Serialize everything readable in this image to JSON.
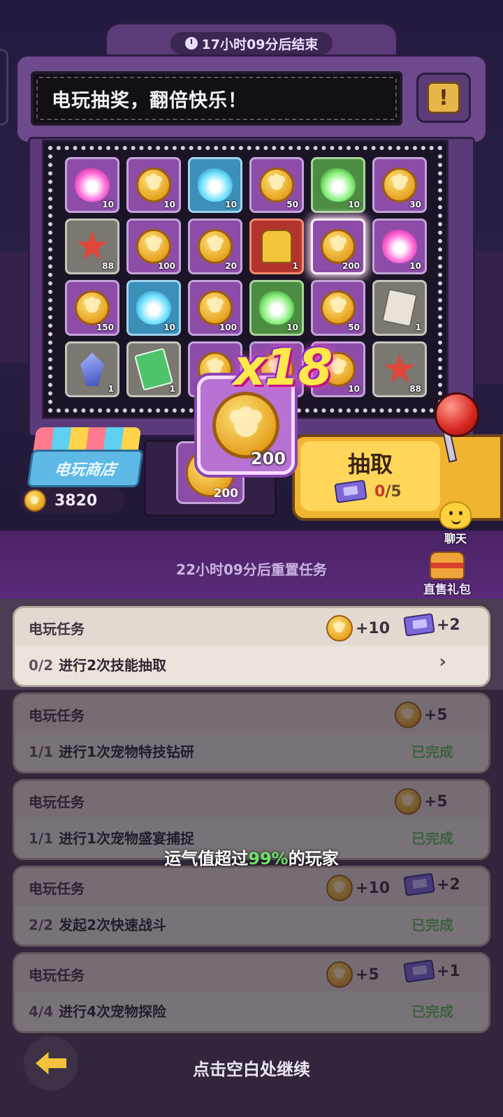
{
  "event": {
    "timer_text": "17小时09分后结束",
    "marquee_text": "电玩抽奖，翻倍快乐！",
    "rules_icon": "scroll-icon"
  },
  "grid": {
    "rows": [
      [
        {
          "item": "pink-gem",
          "count": "10"
        },
        {
          "item": "coin",
          "count": "10"
        },
        {
          "item": "blue-gem",
          "count": "10"
        },
        {
          "item": "coin",
          "count": "50"
        },
        {
          "item": "green-gem",
          "count": "10"
        },
        {
          "item": "coin",
          "count": "30"
        }
      ],
      [
        {
          "item": "starfish",
          "count": "88"
        },
        {
          "item": "coin",
          "count": "100"
        },
        {
          "item": "coin",
          "count": "20"
        },
        {
          "item": "trophy",
          "count": "1"
        },
        {
          "item": "coin",
          "count": "200",
          "highlighted": true
        },
        {
          "item": "pink-gem",
          "count": "10"
        }
      ],
      [
        {
          "item": "coin",
          "count": "150"
        },
        {
          "item": "blue-gem",
          "count": "10"
        },
        {
          "item": "coin",
          "count": "100"
        },
        {
          "item": "green-gem",
          "count": "10"
        },
        {
          "item": "coin",
          "count": "50"
        },
        {
          "item": "skill-card",
          "count": "1"
        }
      ],
      [
        {
          "item": "crystal",
          "count": "1"
        },
        {
          "item": "ticket",
          "count": "1"
        },
        {
          "item": "coin",
          "count": ""
        },
        {
          "item": "coin",
          "count": ""
        },
        {
          "item": "coin",
          "count": "10"
        },
        {
          "item": "starfish",
          "count": "88"
        }
      ]
    ]
  },
  "shop": {
    "label": "电玩商店",
    "balance": "3820"
  },
  "slot": {
    "count": "200"
  },
  "draw": {
    "label": "抽取",
    "used": "0",
    "total": "/5"
  },
  "reward_popup": {
    "multiplier": "x18",
    "count": "200"
  },
  "side_buttons": {
    "chat_label": "聊天",
    "gift_label": "直售礼包"
  },
  "reset_text": "22小时09分后重置任务",
  "tasks": [
    {
      "title": "电玩任务",
      "progress": "0/2",
      "desc": "进行2次技能抽取",
      "status": "",
      "coin_reward": "+10",
      "ticket_reward": "+2"
    },
    {
      "title": "电玩任务",
      "progress": "1/1",
      "desc": "进行1次宠物特技钻研",
      "status": "已完成",
      "coin_reward": "+5",
      "ticket_reward": ""
    },
    {
      "title": "电玩任务",
      "progress": "1/1",
      "desc": "进行1次宠物盛宴捕捉",
      "status": "已完成",
      "coin_reward": "+5",
      "ticket_reward": ""
    },
    {
      "title": "电玩任务",
      "progress": "2/2",
      "desc": "发起2次快速战斗",
      "status": "已完成",
      "coin_reward": "+10",
      "ticket_reward": "+2"
    },
    {
      "title": "电玩任务",
      "progress": "4/4",
      "desc": "进行4次宠物探险",
      "status": "已完成",
      "coin_reward": "+5",
      "ticket_reward": "+1"
    }
  ],
  "luck": {
    "prefix": "运气值超过",
    "percent": "99%",
    "suffix": "的玩家"
  },
  "continue_text": "点击空白处继续"
}
